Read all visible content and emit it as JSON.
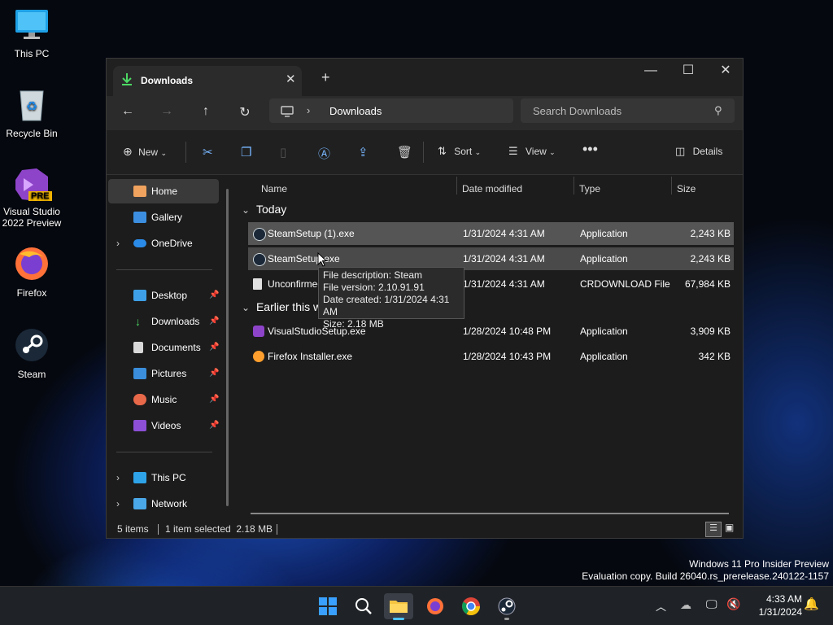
{
  "desktop": {
    "icons": [
      {
        "label": "This PC",
        "icon": "monitor-icon"
      },
      {
        "label": "Recycle Bin",
        "icon": "recycle-bin-icon"
      },
      {
        "label": "Visual Studio 2022 Preview",
        "icon": "visual-studio-icon",
        "badge": "PRE"
      },
      {
        "label": "Firefox",
        "icon": "firefox-icon"
      },
      {
        "label": "Steam",
        "icon": "steam-icon"
      }
    ],
    "watermark_line1": "Windows 11 Pro Insider Preview",
    "watermark_line2": "Evaluation copy. Build 26040.rs_prerelease.240122-1157"
  },
  "window": {
    "tab_title": "Downloads",
    "address": {
      "crumb": "Downloads"
    },
    "search": {
      "placeholder": "Search Downloads"
    },
    "toolbar": {
      "new_label": "New",
      "sort_label": "Sort",
      "view_label": "View",
      "details_label": "Details"
    },
    "nav": {
      "home": "Home",
      "gallery": "Gallery",
      "onedrive": "OneDrive",
      "quick": [
        "Desktop",
        "Downloads",
        "Documents",
        "Pictures",
        "Music",
        "Videos"
      ],
      "thispc": "This PC",
      "network": "Network"
    },
    "columns": {
      "name": "Name",
      "date": "Date modified",
      "type": "Type",
      "size": "Size"
    },
    "groups": {
      "today": "Today",
      "earlier": "Earlier this week"
    },
    "files_today": [
      {
        "name": "SteamSetup (1).exe",
        "date": "1/31/2024 4:31 AM",
        "type": "Application",
        "size": "2,243 KB",
        "icon": "steam-file-icon"
      },
      {
        "name": "SteamSetup.exe",
        "date": "1/31/2024 4:31 AM",
        "type": "Application",
        "size": "2,243 KB",
        "icon": "steam-file-icon"
      },
      {
        "name": "Unconfirmed",
        "date": "1/31/2024 4:31 AM",
        "type": "CRDOWNLOAD File",
        "size": "67,984 KB",
        "icon": "document-file-icon"
      }
    ],
    "files_earlier": [
      {
        "name": "VisualStudioSetup.exe",
        "date": "1/28/2024 10:48 PM",
        "type": "Application",
        "size": "3,909 KB",
        "icon": "visual-studio-file-icon"
      },
      {
        "name": "Firefox Installer.exe",
        "date": "1/28/2024 10:43 PM",
        "type": "Application",
        "size": "342 KB",
        "icon": "firefox-file-icon"
      }
    ],
    "tooltip": {
      "line1": "File description: Steam",
      "line2": "File version: 2.10.91.91",
      "line3": "Date created: 1/31/2024 4:31 AM",
      "line4": "Size: 2.18 MB"
    },
    "status": {
      "items": "5 items",
      "selected": "1 item selected  2.18 MB"
    }
  },
  "taskbar": {
    "time": "4:33 AM",
    "date": "1/31/2024"
  },
  "colors": {
    "selection": "#4a4a4a",
    "accent": "#4cc2ff",
    "folder": "#f5c542"
  }
}
